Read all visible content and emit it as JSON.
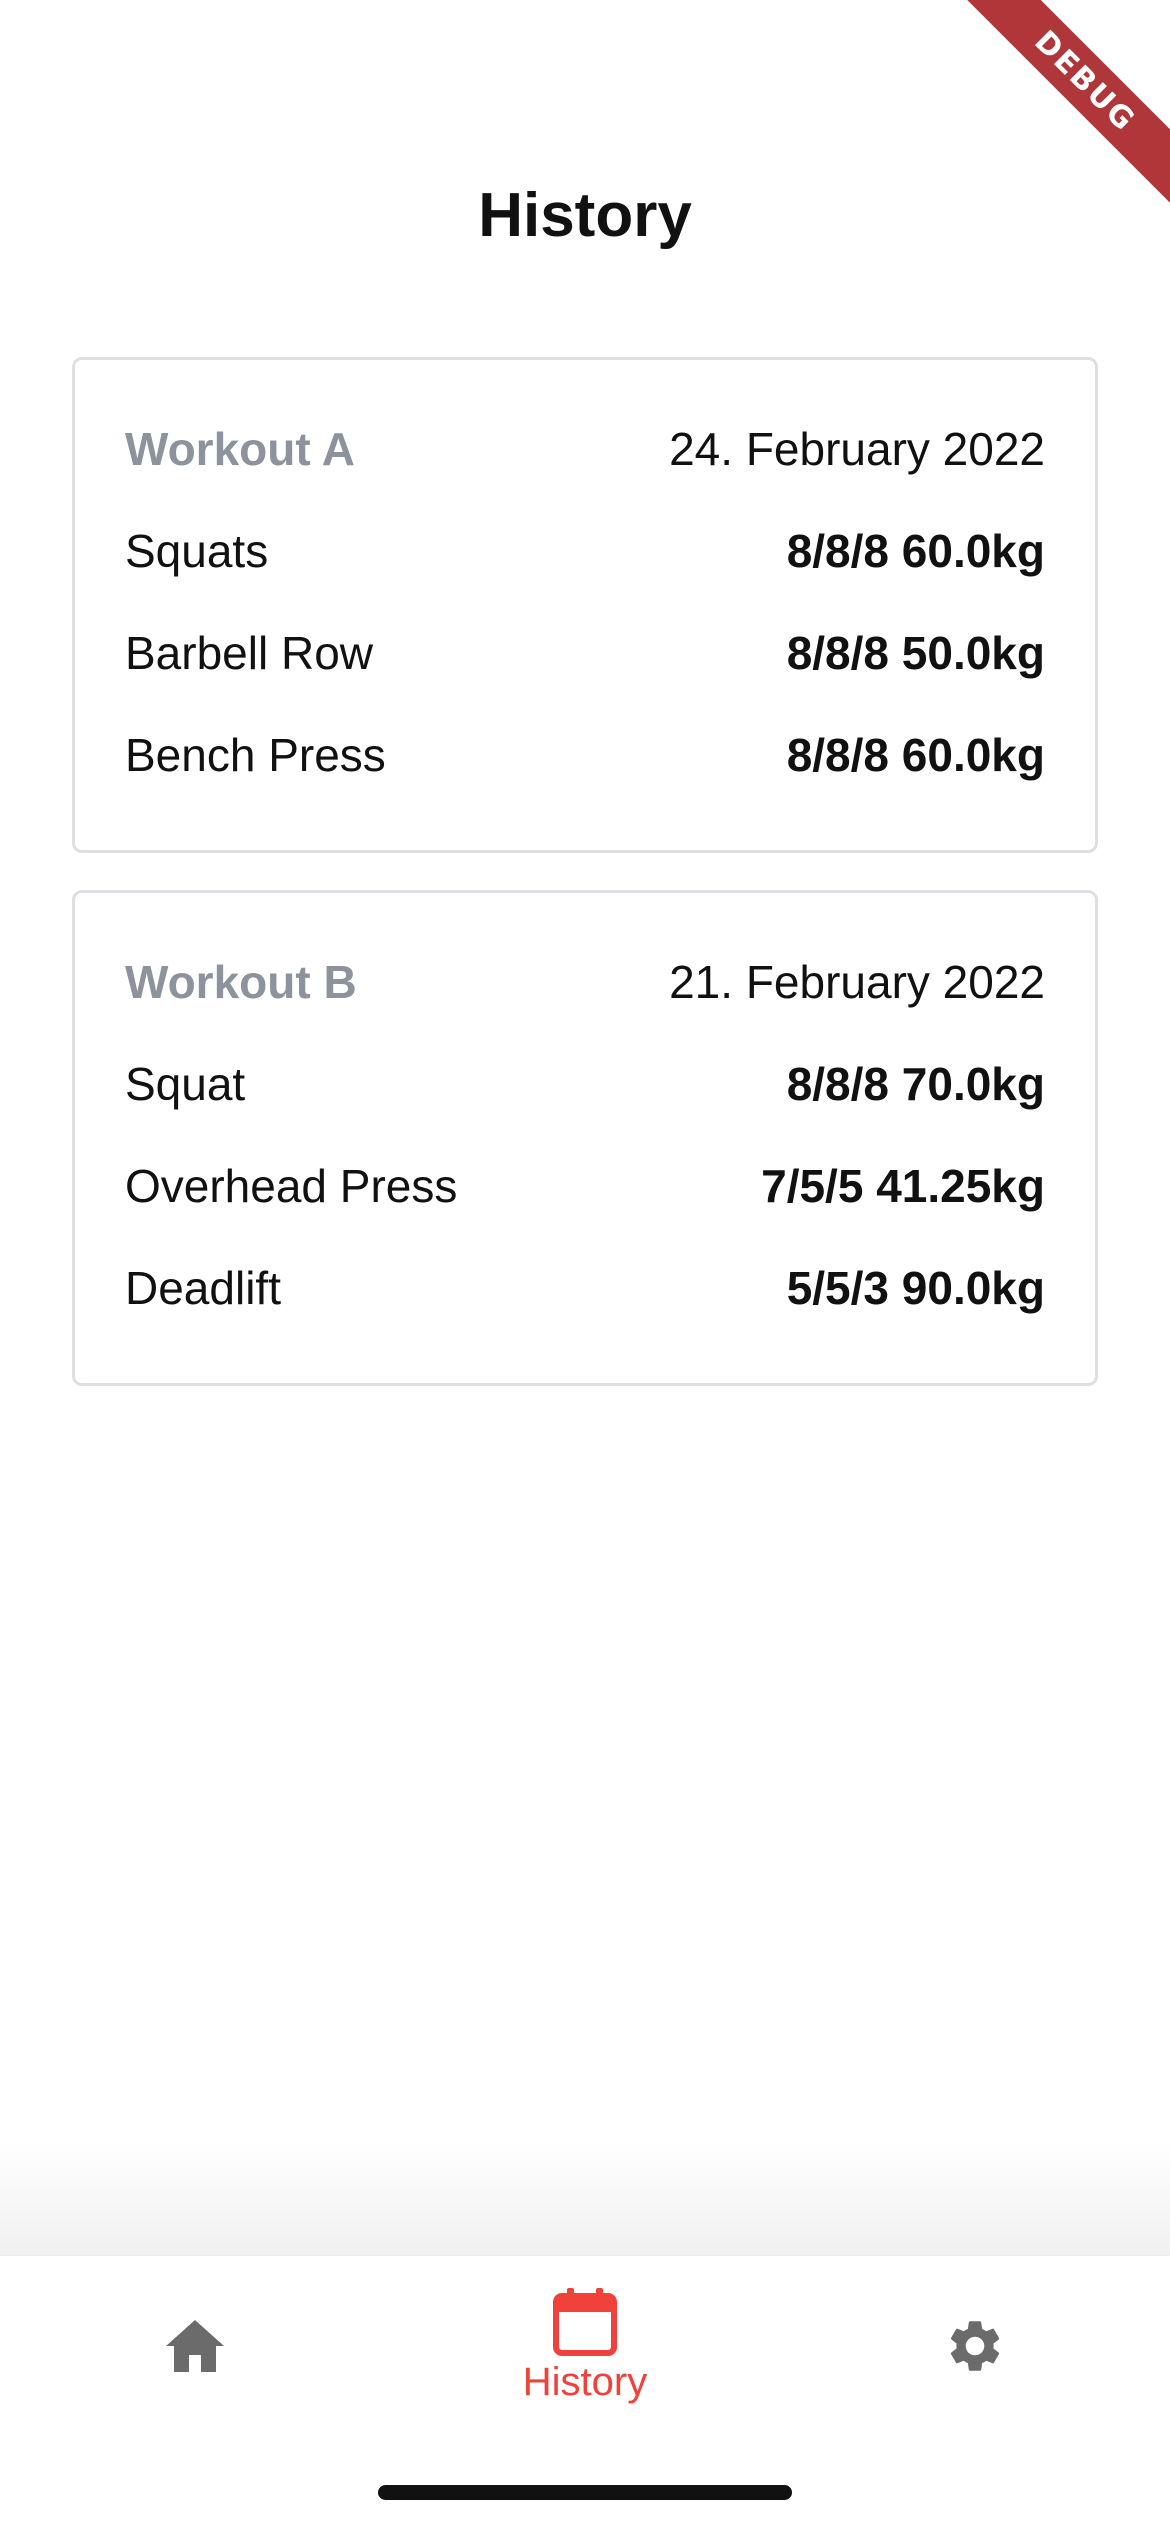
{
  "debug_banner": {
    "label": "DEBUG"
  },
  "page": {
    "title": "History"
  },
  "workouts": [
    {
      "name": "Workout A",
      "date": "24. February 2022",
      "exercises": [
        {
          "name": "Squats",
          "result": "8/8/8 60.0kg"
        },
        {
          "name": "Barbell Row",
          "result": "8/8/8 50.0kg"
        },
        {
          "name": "Bench Press",
          "result": "8/8/8 60.0kg"
        }
      ]
    },
    {
      "name": "Workout B",
      "date": "21. February 2022",
      "exercises": [
        {
          "name": "Squat",
          "result": "8/8/8 70.0kg"
        },
        {
          "name": "Overhead Press",
          "result": "7/5/5 41.25kg"
        },
        {
          "name": "Deadlift",
          "result": "5/5/3 90.0kg"
        }
      ]
    }
  ],
  "bottom_nav": {
    "items": [
      {
        "icon": "home-icon",
        "label": ""
      },
      {
        "icon": "calendar-icon",
        "label": "History",
        "active": true
      },
      {
        "icon": "gear-icon",
        "label": ""
      }
    ]
  },
  "colors": {
    "accent": "#f0413a",
    "inactive_icon": "#6b6b6b",
    "workout_name": "#8c939c",
    "card_border": "#dddfe3",
    "debug_banner": "#b0363a"
  }
}
